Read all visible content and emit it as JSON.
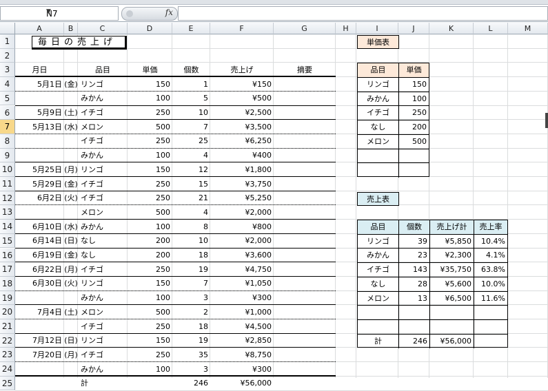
{
  "formula_bar": {
    "name_box": "N7",
    "fx_label": "fx",
    "formula": ""
  },
  "columns": [
    "A",
    "B",
    "C",
    "D",
    "E",
    "F",
    "G",
    "H",
    "I",
    "J",
    "K",
    "L",
    "M"
  ],
  "rows": [
    "1",
    "2",
    "3",
    "4",
    "5",
    "6",
    "7",
    "8",
    "9",
    "10",
    "11",
    "12",
    "13",
    "14",
    "15",
    "16",
    "17",
    "18",
    "19",
    "20",
    "21",
    "22",
    "23",
    "24",
    "25"
  ],
  "active_row": "7",
  "sheet": {
    "title": "毎日の売上げ",
    "headers": {
      "date": "月日",
      "item": "品目",
      "price": "単価",
      "qty": "個数",
      "sales": "売上げ",
      "note": "摘要"
    },
    "records": [
      {
        "date": "5月1日",
        "dow": "(金)",
        "item": "リンゴ",
        "price": "150",
        "qty": "1",
        "sales": "¥150"
      },
      {
        "date": "",
        "dow": "",
        "item": "みかん",
        "price": "100",
        "qty": "5",
        "sales": "¥500"
      },
      {
        "date": "5月9日",
        "dow": "(土)",
        "item": "イチゴ",
        "price": "250",
        "qty": "10",
        "sales": "¥2,500"
      },
      {
        "date": "5月13日",
        "dow": "(水)",
        "item": "メロン",
        "price": "500",
        "qty": "7",
        "sales": "¥3,500"
      },
      {
        "date": "",
        "dow": "",
        "item": "イチゴ",
        "price": "250",
        "qty": "25",
        "sales": "¥6,250"
      },
      {
        "date": "",
        "dow": "",
        "item": "みかん",
        "price": "100",
        "qty": "4",
        "sales": "¥400"
      },
      {
        "date": "5月25日",
        "dow": "(月)",
        "item": "リンゴ",
        "price": "150",
        "qty": "12",
        "sales": "¥1,800"
      },
      {
        "date": "5月29日",
        "dow": "(金)",
        "item": "イチゴ",
        "price": "250",
        "qty": "15",
        "sales": "¥3,750"
      },
      {
        "date": "6月2日",
        "dow": "(火)",
        "item": "イチゴ",
        "price": "250",
        "qty": "21",
        "sales": "¥5,250"
      },
      {
        "date": "",
        "dow": "",
        "item": "メロン",
        "price": "500",
        "qty": "4",
        "sales": "¥2,000"
      },
      {
        "date": "6月10日",
        "dow": "(水)",
        "item": "みかん",
        "price": "100",
        "qty": "8",
        "sales": "¥800"
      },
      {
        "date": "6月14日",
        "dow": "(日)",
        "item": "なし",
        "price": "200",
        "qty": "10",
        "sales": "¥2,000"
      },
      {
        "date": "6月19日",
        "dow": "(金)",
        "item": "なし",
        "price": "200",
        "qty": "18",
        "sales": "¥3,600"
      },
      {
        "date": "6月22日",
        "dow": "(月)",
        "item": "イチゴ",
        "price": "250",
        "qty": "19",
        "sales": "¥4,750"
      },
      {
        "date": "6月30日",
        "dow": "(火)",
        "item": "リンゴ",
        "price": "150",
        "qty": "7",
        "sales": "¥1,050"
      },
      {
        "date": "",
        "dow": "",
        "item": "みかん",
        "price": "100",
        "qty": "3",
        "sales": "¥300"
      },
      {
        "date": "7月4日",
        "dow": "(土)",
        "item": "メロン",
        "price": "500",
        "qty": "2",
        "sales": "¥1,000"
      },
      {
        "date": "",
        "dow": "",
        "item": "イチゴ",
        "price": "250",
        "qty": "18",
        "sales": "¥4,500"
      },
      {
        "date": "7月12日",
        "dow": "(日)",
        "item": "リンゴ",
        "price": "150",
        "qty": "19",
        "sales": "¥2,850"
      },
      {
        "date": "7月20日",
        "dow": "(月)",
        "item": "イチゴ",
        "price": "250",
        "qty": "35",
        "sales": "¥8,750"
      },
      {
        "date": "",
        "dow": "",
        "item": "みかん",
        "price": "100",
        "qty": "3",
        "sales": "¥300"
      }
    ],
    "total": {
      "label": "計",
      "qty": "246",
      "sales": "¥56,000"
    }
  },
  "price_table": {
    "title": "単価表",
    "headers": {
      "item": "品目",
      "price": "単価"
    },
    "rows": [
      {
        "item": "リンゴ",
        "price": "150"
      },
      {
        "item": "みかん",
        "price": "100"
      },
      {
        "item": "イチゴ",
        "price": "250"
      },
      {
        "item": "なし",
        "price": "200"
      },
      {
        "item": "メロン",
        "price": "500"
      },
      {
        "item": "",
        "price": ""
      },
      {
        "item": "",
        "price": ""
      }
    ]
  },
  "sales_table": {
    "title": "売上表",
    "headers": {
      "item": "品目",
      "qty": "個数",
      "total": "売上げ計",
      "rate": "売上率"
    },
    "rows": [
      {
        "item": "リンゴ",
        "qty": "39",
        "total": "¥5,850",
        "rate": "10.4%"
      },
      {
        "item": "みかん",
        "qty": "23",
        "total": "¥2,300",
        "rate": "4.1%"
      },
      {
        "item": "イチゴ",
        "qty": "143",
        "total": "¥35,750",
        "rate": "63.8%"
      },
      {
        "item": "なし",
        "qty": "28",
        "total": "¥5,600",
        "rate": "10.0%"
      },
      {
        "item": "メロン",
        "qty": "13",
        "total": "¥6,500",
        "rate": "11.6%"
      },
      {
        "item": "",
        "qty": "",
        "total": "",
        "rate": ""
      },
      {
        "item": "",
        "qty": "",
        "total": "",
        "rate": ""
      }
    ],
    "total": {
      "label": "計",
      "qty": "246",
      "total": "¥56,000",
      "rate": ""
    }
  },
  "colors": {
    "price_header": "#fde9d9",
    "sales_header": "#daeef3",
    "active_row": "#f8d88a"
  }
}
